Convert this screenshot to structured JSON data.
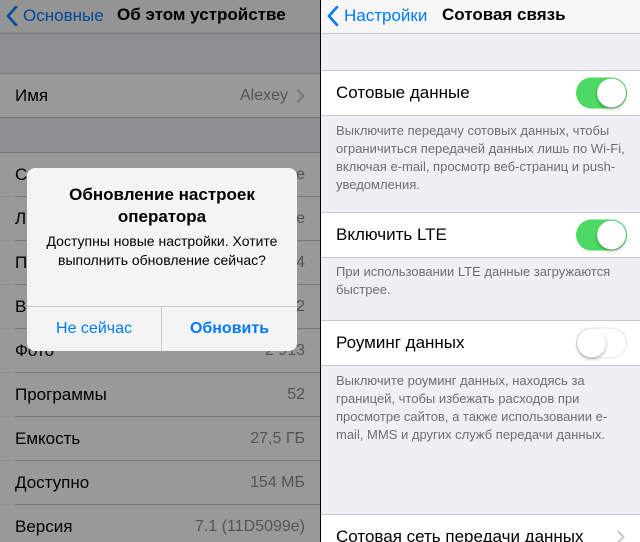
{
  "left": {
    "back_label": "Основные",
    "title": "Об этом устройстве",
    "name_row": {
      "label": "Имя",
      "value": "Alexey"
    },
    "rows": [
      {
        "label": "С",
        "value": "е"
      },
      {
        "label": "Л",
        "value": "е"
      },
      {
        "label": "П",
        "value": "4"
      },
      {
        "label": "В",
        "value": "2"
      },
      {
        "label": "Фото",
        "value": "2 913"
      },
      {
        "label": "Программы",
        "value": "52"
      },
      {
        "label": "Емкость",
        "value": "27,5 ГБ"
      },
      {
        "label": "Доступно",
        "value": "154 МБ"
      },
      {
        "label": "Версия",
        "value": "7.1 (11D5099e)"
      }
    ],
    "alert": {
      "title": "Обновление настроек оператора",
      "message": "Доступны новые настройки. Хотите выполнить обновление сейчас?",
      "cancel": "Не сейчас",
      "confirm": "Обновить"
    }
  },
  "right": {
    "back_label": "Настройки",
    "title": "Сотовая связь",
    "cellular_data": {
      "label": "Сотовые данные",
      "on": true,
      "note": "Выключите передачу сотовых данных, чтобы ограничиться передачей данных лишь по Wi-Fi, включая e-mail, просмотр веб-страниц и push-уведомления."
    },
    "lte": {
      "label": "Включить LTE",
      "on": true,
      "note": "При использовании LTE данные загружаются быстрее."
    },
    "roaming": {
      "label": "Роуминг данных",
      "on": false,
      "note": "Выключите роуминг данных, находясь за границей, чтобы избежать расходов при просмотре сайтов, а также использовании e-mail, MMS и других служб передачи данных."
    },
    "network_row": {
      "label": "Сотовая сеть передачи данных"
    }
  },
  "colors": {
    "accent": "#007aff",
    "toggle_on": "#4cd964",
    "group_bg": "#efeff4"
  }
}
